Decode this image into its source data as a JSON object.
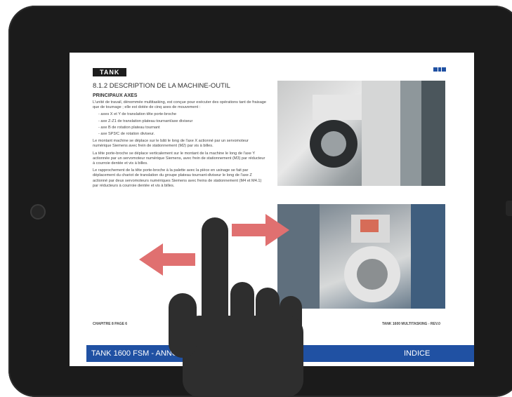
{
  "page": {
    "brand": "TANK",
    "section_title": "8.1.2 DESCRIPTION DE LA MACHINE-OUTIL",
    "subtitle": "PRINCIPAUX AXES",
    "intro": "L'unité de travail, dénommée multitasking, est conçue pour exécuter des opérations tant de fraisage que de tournage ; elle est dotée de cinq axes de mouvement :",
    "axes": [
      "axes X et Y de translation tête porte-broche",
      "axe Z-Z1 de translation plateau tournant/axe diviseur",
      "axe B de rotation plateau tournant",
      "axe SP3/C de rotation diviseur."
    ],
    "para1": "Le montant machine se déplace sur le bâti le long de l'axe X actionné par un servomoteur numérique Siemens avec frein de stationnement (M2) par vis à billes.",
    "para2": "La tête porte-broche se déplace verticalement sur le montant de la machine le long de l'axe Y actionnée par un servomoteur numérique Siemens, avec frein de stationnement (M3) par réducteur à courroie dentée et vis à billes.",
    "para3": "Le rapprochement de la tête porte-broche à la palette avec la pièce en usinage se fait par déplacement du chariot de translation du groupe plateau tournant-diviseur le long de l'axe Z actionné par deux servomoteurs numériques Siemens avec freins de stationnement (M4 et M4.1) par réducteurs à courroie dentée et vis à billes.",
    "footer_left": "CHAPITRE 8 PAGE 6",
    "footer_right": "TANK 1600 MULTITASKING - REV.0"
  },
  "bottom_bar": {
    "text": "TANK 1600 FSM - ANNO: 2015 - M",
    "indice": "INDICE"
  },
  "colors": {
    "bar": "#2051a3",
    "arrow": "#e07070",
    "hand": "#2e2e2e",
    "bezel": "#1b1b1b"
  },
  "icons": [
    "swipe-left-arrow-icon",
    "swipe-right-arrow-icon",
    "hand-pointer-icon",
    "home-button-icon"
  ]
}
